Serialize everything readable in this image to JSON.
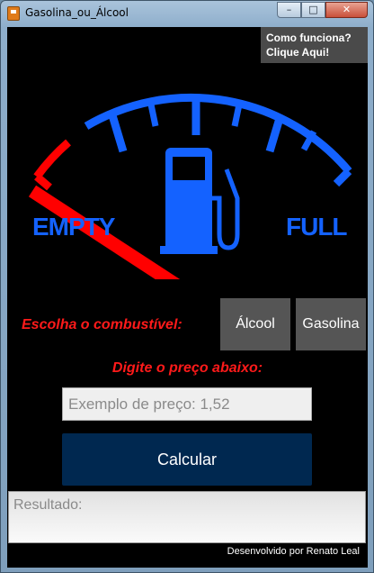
{
  "window": {
    "title": "Gasolina_ou_Álcool",
    "minimize_label": "–",
    "maximize_label": "□",
    "close_label": "✕"
  },
  "help": {
    "line1": "Como funciona?",
    "line2": "Clique Aqui!"
  },
  "gauge": {
    "empty_label": "EMPTY",
    "full_label": "FULL",
    "icon": "fuel-pump-icon",
    "needle_level": 0.0,
    "colors": {
      "accent": "#1462ff",
      "warning": "#ff0000"
    }
  },
  "fuel_choice": {
    "label": "Escolha o combustível:",
    "alcool": "Álcool",
    "gasolina": "Gasolina"
  },
  "price": {
    "label": "Digite o preço abaixo:",
    "placeholder": "Exemplo de preço: 1,52"
  },
  "calculate_label": "Calcular",
  "result_placeholder": "Resultado:",
  "credit": "Desenvolvido por Renato Leal"
}
